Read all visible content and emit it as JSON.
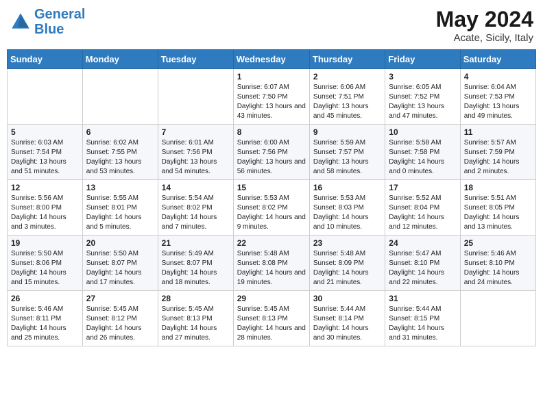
{
  "header": {
    "logo_line1": "General",
    "logo_line2": "Blue",
    "month": "May 2024",
    "location": "Acate, Sicily, Italy"
  },
  "weekdays": [
    "Sunday",
    "Monday",
    "Tuesday",
    "Wednesday",
    "Thursday",
    "Friday",
    "Saturday"
  ],
  "weeks": [
    [
      {
        "day": "",
        "info": ""
      },
      {
        "day": "",
        "info": ""
      },
      {
        "day": "",
        "info": ""
      },
      {
        "day": "1",
        "info": "Sunrise: 6:07 AM\nSunset: 7:50 PM\nDaylight: 13 hours\nand 43 minutes."
      },
      {
        "day": "2",
        "info": "Sunrise: 6:06 AM\nSunset: 7:51 PM\nDaylight: 13 hours\nand 45 minutes."
      },
      {
        "day": "3",
        "info": "Sunrise: 6:05 AM\nSunset: 7:52 PM\nDaylight: 13 hours\nand 47 minutes."
      },
      {
        "day": "4",
        "info": "Sunrise: 6:04 AM\nSunset: 7:53 PM\nDaylight: 13 hours\nand 49 minutes."
      }
    ],
    [
      {
        "day": "5",
        "info": "Sunrise: 6:03 AM\nSunset: 7:54 PM\nDaylight: 13 hours\nand 51 minutes."
      },
      {
        "day": "6",
        "info": "Sunrise: 6:02 AM\nSunset: 7:55 PM\nDaylight: 13 hours\nand 53 minutes."
      },
      {
        "day": "7",
        "info": "Sunrise: 6:01 AM\nSunset: 7:56 PM\nDaylight: 13 hours\nand 54 minutes."
      },
      {
        "day": "8",
        "info": "Sunrise: 6:00 AM\nSunset: 7:56 PM\nDaylight: 13 hours\nand 56 minutes."
      },
      {
        "day": "9",
        "info": "Sunrise: 5:59 AM\nSunset: 7:57 PM\nDaylight: 13 hours\nand 58 minutes."
      },
      {
        "day": "10",
        "info": "Sunrise: 5:58 AM\nSunset: 7:58 PM\nDaylight: 14 hours\nand 0 minutes."
      },
      {
        "day": "11",
        "info": "Sunrise: 5:57 AM\nSunset: 7:59 PM\nDaylight: 14 hours\nand 2 minutes."
      }
    ],
    [
      {
        "day": "12",
        "info": "Sunrise: 5:56 AM\nSunset: 8:00 PM\nDaylight: 14 hours\nand 3 minutes."
      },
      {
        "day": "13",
        "info": "Sunrise: 5:55 AM\nSunset: 8:01 PM\nDaylight: 14 hours\nand 5 minutes."
      },
      {
        "day": "14",
        "info": "Sunrise: 5:54 AM\nSunset: 8:02 PM\nDaylight: 14 hours\nand 7 minutes."
      },
      {
        "day": "15",
        "info": "Sunrise: 5:53 AM\nSunset: 8:02 PM\nDaylight: 14 hours\nand 9 minutes."
      },
      {
        "day": "16",
        "info": "Sunrise: 5:53 AM\nSunset: 8:03 PM\nDaylight: 14 hours\nand 10 minutes."
      },
      {
        "day": "17",
        "info": "Sunrise: 5:52 AM\nSunset: 8:04 PM\nDaylight: 14 hours\nand 12 minutes."
      },
      {
        "day": "18",
        "info": "Sunrise: 5:51 AM\nSunset: 8:05 PM\nDaylight: 14 hours\nand 13 minutes."
      }
    ],
    [
      {
        "day": "19",
        "info": "Sunrise: 5:50 AM\nSunset: 8:06 PM\nDaylight: 14 hours\nand 15 minutes."
      },
      {
        "day": "20",
        "info": "Sunrise: 5:50 AM\nSunset: 8:07 PM\nDaylight: 14 hours\nand 17 minutes."
      },
      {
        "day": "21",
        "info": "Sunrise: 5:49 AM\nSunset: 8:07 PM\nDaylight: 14 hours\nand 18 minutes."
      },
      {
        "day": "22",
        "info": "Sunrise: 5:48 AM\nSunset: 8:08 PM\nDaylight: 14 hours\nand 19 minutes."
      },
      {
        "day": "23",
        "info": "Sunrise: 5:48 AM\nSunset: 8:09 PM\nDaylight: 14 hours\nand 21 minutes."
      },
      {
        "day": "24",
        "info": "Sunrise: 5:47 AM\nSunset: 8:10 PM\nDaylight: 14 hours\nand 22 minutes."
      },
      {
        "day": "25",
        "info": "Sunrise: 5:46 AM\nSunset: 8:10 PM\nDaylight: 14 hours\nand 24 minutes."
      }
    ],
    [
      {
        "day": "26",
        "info": "Sunrise: 5:46 AM\nSunset: 8:11 PM\nDaylight: 14 hours\nand 25 minutes."
      },
      {
        "day": "27",
        "info": "Sunrise: 5:45 AM\nSunset: 8:12 PM\nDaylight: 14 hours\nand 26 minutes."
      },
      {
        "day": "28",
        "info": "Sunrise: 5:45 AM\nSunset: 8:13 PM\nDaylight: 14 hours\nand 27 minutes."
      },
      {
        "day": "29",
        "info": "Sunrise: 5:45 AM\nSunset: 8:13 PM\nDaylight: 14 hours\nand 28 minutes."
      },
      {
        "day": "30",
        "info": "Sunrise: 5:44 AM\nSunset: 8:14 PM\nDaylight: 14 hours\nand 30 minutes."
      },
      {
        "day": "31",
        "info": "Sunrise: 5:44 AM\nSunset: 8:15 PM\nDaylight: 14 hours\nand 31 minutes."
      },
      {
        "day": "",
        "info": ""
      }
    ]
  ]
}
